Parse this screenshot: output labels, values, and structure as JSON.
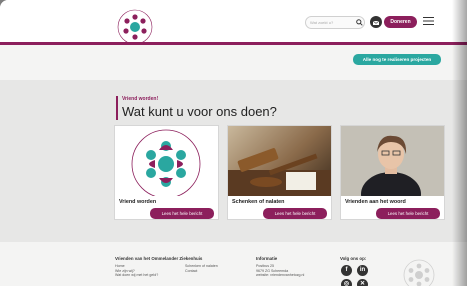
{
  "header": {
    "search_placeholder": "Wat zoekt u?",
    "donate_label": "Doneren"
  },
  "projects_button": "Alle nog te realiseren projecten",
  "intro": {
    "kicker": "Vriend worden!",
    "title": "Wat kunt u voor ons doen?"
  },
  "cards": [
    {
      "title": "Vriend worden",
      "cta": "Lees het hele bericht"
    },
    {
      "title": "Schenken of nalaten",
      "cta": "Lees het hele bericht"
    },
    {
      "title": "Vrienden aan het woord",
      "cta": "Lees het hele bericht"
    }
  ],
  "footer": {
    "col1_heading": "Vrienden van het Ommelander Ziekenhuis",
    "col1_links": [
      "Home",
      "Wie zijn wij?",
      "Wat doen wij met het geld?"
    ],
    "col1b_links": [
      "Schenken of nalaten",
      "Contact"
    ],
    "col2_heading": "Informatie",
    "col2_lines": [
      "Postbus 25",
      "9679 ZG Scheemda",
      "website: vriendenvanhetozg.nl"
    ],
    "col3_heading": "Volg ons op:"
  },
  "colors": {
    "brand": "#8c1f5c",
    "accent": "#2aa7a0"
  }
}
